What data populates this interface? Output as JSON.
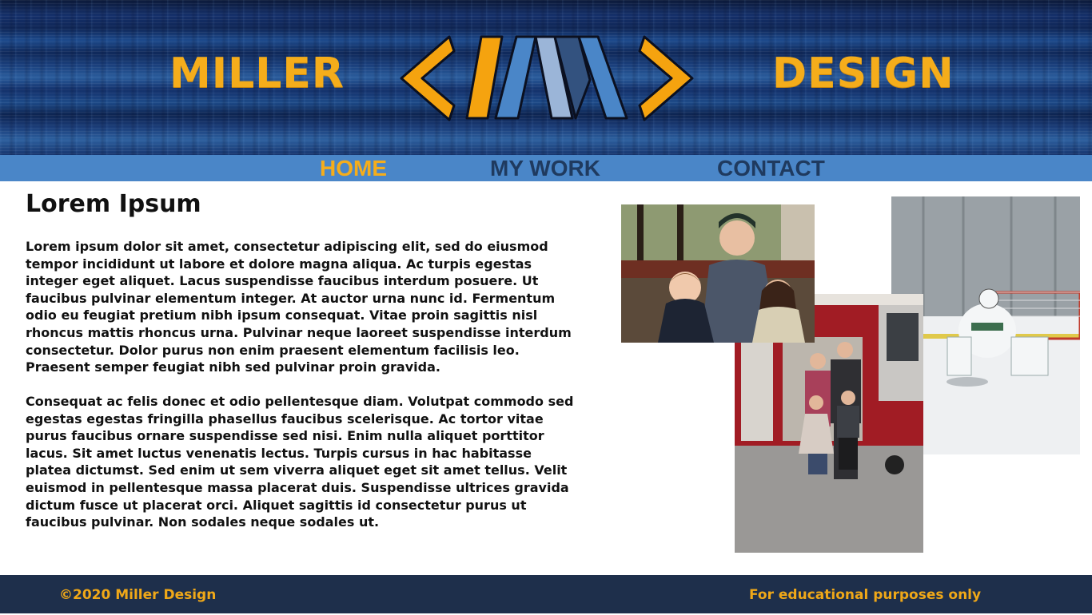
{
  "banner": {
    "brand_left": "MILLER",
    "brand_right": "DESIGN",
    "logo_icon": "miller-design-logo",
    "colors": {
      "brand_gold": "#f5ad1b",
      "logo_orange": "#f5a30f",
      "logo_blue": "#4a86c8",
      "logo_light_blue": "#9bb5d8",
      "logo_dark_blue": "#33527f"
    }
  },
  "nav": {
    "items": [
      {
        "label": "HOME",
        "active": true
      },
      {
        "label": "MY WORK",
        "active": false
      },
      {
        "label": "CONTACT",
        "active": false
      }
    ],
    "colors": {
      "bar": "#4a86c8",
      "active": "#f5ad1b",
      "inactive": "#1f3a5f"
    }
  },
  "main": {
    "title": "Lorem Ipsum",
    "paragraphs": [
      "Lorem ipsum dolor sit amet, consectetur adipiscing elit, sed do eiusmod tempor incididunt ut labore et dolore magna aliqua. Ac turpis egestas integer eget aliquet. Lacus suspendisse faucibus interdum posuere. Ut faucibus pulvinar elementum integer. At auctor urna nunc id. Fermentum odio eu feugiat pretium nibh ipsum consequat. Vitae proin sagittis nisl rhoncus mattis rhoncus urna. Pulvinar neque laoreet suspendisse interdum consectetur. Dolor purus non enim praesent elementum facilisis leo. Praesent semper feugiat nibh sed pulvinar proin gravida.",
      "Consequat ac felis donec et odio pellentesque diam. Volutpat commodo sed egestas egestas fringilla phasellus faucibus scelerisque. Ac tortor vitae purus faucibus ornare suspendisse sed nisi. Enim nulla aliquet porttitor lacus. Sit amet luctus venenatis lectus. Turpis cursus in hac habitasse platea dictumst. Sed enim ut sem viverra aliquet eget sit amet tellus. Velit euismod in pellentesque massa placerat duis. Suspendisse ultrices gravida dictum fusce ut placerat orci. Aliquet sagittis id consectetur purus ut faucibus pulvinar. Non sodales neque sodales ut."
    ]
  },
  "photos": {
    "family": "family-photo",
    "firetruck": "fire-truck-photo",
    "hockey": "hockey-goalie-photo"
  },
  "footer": {
    "copyright": "©2020 Miller Design",
    "note": "For educational purposes only",
    "colors": {
      "background": "#1e2f4b",
      "text": "#f0a818"
    }
  }
}
